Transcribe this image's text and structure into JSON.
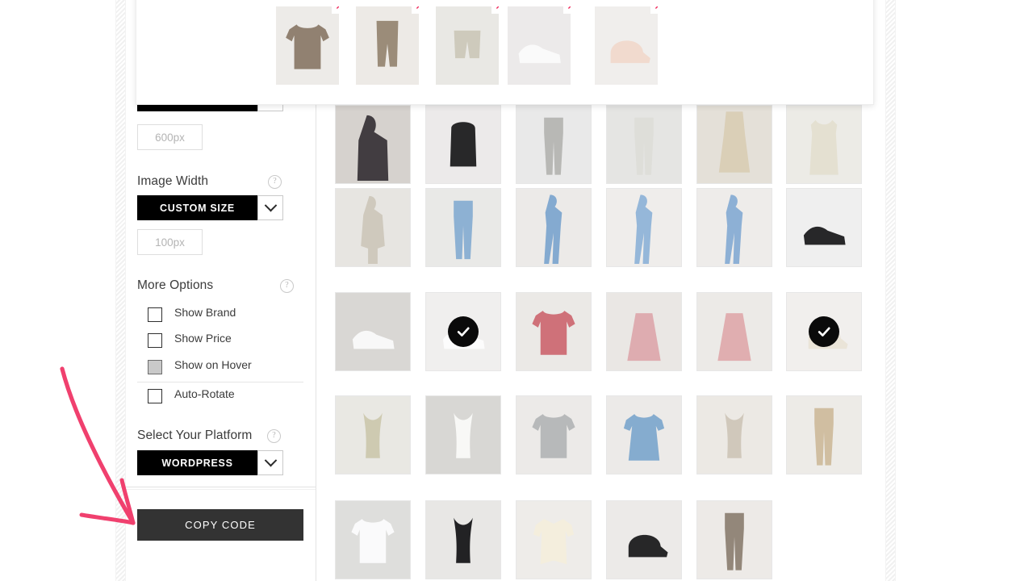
{
  "app": {
    "accent_pink": "#f0295c",
    "button_dark": "#333333",
    "select_black": "#000000"
  },
  "sidebar": {
    "image_height_value": "600px",
    "image_width": {
      "label": "Image Width",
      "help_icon": "help-circle-icon",
      "select_value": "CUSTOM SIZE",
      "chevron_icon": "chevron-down-icon",
      "value": "100px"
    },
    "more_options": {
      "label": "More Options",
      "help_icon": "help-circle-icon",
      "checkboxes": [
        {
          "label": "Show Brand",
          "checked": false,
          "state": "unchecked"
        },
        {
          "label": "Show Price",
          "checked": false,
          "state": "unchecked"
        },
        {
          "label": "Show on Hover",
          "checked": true,
          "state": "filled"
        },
        {
          "label": "Auto-Rotate",
          "checked": false,
          "state": "unchecked"
        }
      ]
    },
    "platform": {
      "label": "Select Your Platform",
      "help_icon": "help-circle-icon",
      "select_value": "WORDPRESS",
      "chevron_icon": "chevron-down-icon"
    },
    "copy_code_label": "COPY CODE"
  },
  "selected_strip": {
    "close_icon": "close-x-icon",
    "items": [
      {
        "name": "taupe-short-sleeve-tee",
        "bg": "#edebe8",
        "shape": "tee",
        "color": "#8c7b6a"
      },
      {
        "name": "taupe-bike-shorts",
        "bg": "#edeae6",
        "shape": "shorts-long",
        "color": "#978773"
      },
      {
        "name": "beige-sweat-shorts",
        "bg": "#e9e8e4",
        "shape": "shorts",
        "color": "#ccc8b9"
      },
      {
        "name": "white-running-sneakers",
        "bg": "#eceaea",
        "shape": "sneakers",
        "color": "#fbfbfb"
      },
      {
        "name": "blush-baseball-cap",
        "bg": "#f0eeec",
        "shape": "cap",
        "color": "#f0d8cc"
      }
    ]
  },
  "grid": {
    "check_icon": "check-circle-icon",
    "rows": [
      [
        {
          "name": "black-blouse-model",
          "bg": "#d6d2ce",
          "shape": "model-dark",
          "color": "#3a3539",
          "selected": false
        },
        {
          "name": "black-backpack",
          "bg": "#eceaea",
          "shape": "backpack",
          "color": "#1d1d1f",
          "selected": false
        },
        {
          "name": "grey-check-trousers",
          "bg": "#e9e9e9",
          "shape": "pants",
          "color": "#b5b5b2",
          "selected": false
        },
        {
          "name": "white-straight-trousers",
          "bg": "#e5e5e3",
          "shape": "pants",
          "color": "#ddddd8",
          "selected": false
        },
        {
          "name": "beige-midi-skirt-model",
          "bg": "#e4e0d8",
          "shape": "skirt-model",
          "color": "#d9cdb5",
          "selected": false
        },
        {
          "name": "cream-wrap-dress",
          "bg": "#ecebe6",
          "shape": "dress-long",
          "color": "#e4dfd0",
          "selected": false
        }
      ],
      [
        {
          "name": "beige-tshirt-dress-model",
          "bg": "#e7e5e1",
          "shape": "dress-model",
          "color": "#cdc7bb",
          "selected": false
        },
        {
          "name": "light-blue-jeans-flat",
          "bg": "#e9e9e7",
          "shape": "jeans",
          "color": "#88aed2",
          "selected": false
        },
        {
          "name": "blue-skinny-jeans-model-a",
          "bg": "#eceae8",
          "shape": "jeans-model",
          "color": "#7ea7cf",
          "selected": false
        },
        {
          "name": "blue-skinny-jeans-model-b",
          "bg": "#efedeb",
          "shape": "jeans-model",
          "color": "#8fb4d8",
          "selected": false
        },
        {
          "name": "striped-shirt-jeans-model",
          "bg": "#eeecea",
          "shape": "jeans-model",
          "color": "#87add4",
          "selected": false
        },
        {
          "name": "black-sneakers",
          "bg": "#efefef",
          "shape": "sneakers-dark",
          "color": "#1b1b1d",
          "selected": false
        }
      ],
      [
        {
          "name": "white-adidas-sneakers",
          "bg": "#d9d7d4",
          "shape": "sneakers",
          "color": "#fafafa",
          "selected": false
        },
        {
          "name": "white-running-shoes",
          "bg": "#f0efee",
          "shape": "sneakers",
          "color": "#fcfcfc",
          "selected": true
        },
        {
          "name": "rose-pink-tee",
          "bg": "#ebe9e6",
          "shape": "tee",
          "color": "#cd6a73",
          "selected": false
        },
        {
          "name": "pink-pleated-skirt-a",
          "bg": "#eae7e4",
          "shape": "skirt",
          "color": "#dda9ad",
          "selected": false
        },
        {
          "name": "pink-pleated-skirt-b",
          "bg": "#eceae7",
          "shape": "skirt",
          "color": "#dfabad",
          "selected": false
        },
        {
          "name": "cream-baseball-cap",
          "bg": "#f1efed",
          "shape": "cap",
          "color": "#e9e3d7",
          "selected": true
        }
      ],
      [
        {
          "name": "beige-knit-camisole",
          "bg": "#e9e8e3",
          "shape": "tank",
          "color": "#ccc8ae",
          "selected": false
        },
        {
          "name": "white-ribbed-tank",
          "bg": "#d8d7d4",
          "shape": "tank",
          "color": "#fafaf8",
          "selected": false
        },
        {
          "name": "grey-ribbed-tee",
          "bg": "#eceae8",
          "shape": "tee",
          "color": "#b4b6b7",
          "selected": false
        },
        {
          "name": "blue-smock-dress",
          "bg": "#eceae8",
          "shape": "dress",
          "color": "#7fa9cd",
          "selected": false
        },
        {
          "name": "beige-knit-tank",
          "bg": "#ece9e4",
          "shape": "tank",
          "color": "#cfc6b8",
          "selected": false
        },
        {
          "name": "beige-straight-jeans",
          "bg": "#edebe7",
          "shape": "pants",
          "color": "#cfbc9d",
          "selected": false
        }
      ],
      [
        {
          "name": "white-tshirt",
          "bg": "#dededc",
          "shape": "tee",
          "color": "#fbfbfc",
          "selected": false
        },
        {
          "name": "black-ribbed-tank",
          "bg": "#e8e7e5",
          "shape": "tank",
          "color": "#171719",
          "selected": false
        },
        {
          "name": "cream-button-cardigan",
          "bg": "#eeece9",
          "shape": "cardigan",
          "color": "#f3eedc",
          "selected": false
        },
        {
          "name": "black-baseball-cap",
          "bg": "#eceae8",
          "shape": "cap",
          "color": "#1c1c1e",
          "selected": false
        },
        {
          "name": "brown-check-trousers",
          "bg": "#edeae7",
          "shape": "pants",
          "color": "#8e8274",
          "selected": false
        }
      ]
    ]
  },
  "annotation": {
    "name": "pink-arrow-pointing-to-copy-code",
    "color": "#f0406e"
  }
}
